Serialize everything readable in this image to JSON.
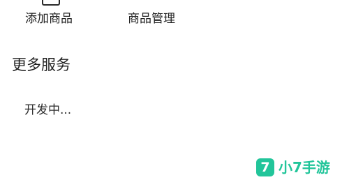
{
  "shortcuts": {
    "add_product": "添加商品",
    "manage_products": "商品管理"
  },
  "more_services": {
    "title": "更多服务",
    "status": "开发中..."
  },
  "watermark": {
    "badge": "7",
    "text": "小7手游",
    "color": "#22c59a"
  }
}
